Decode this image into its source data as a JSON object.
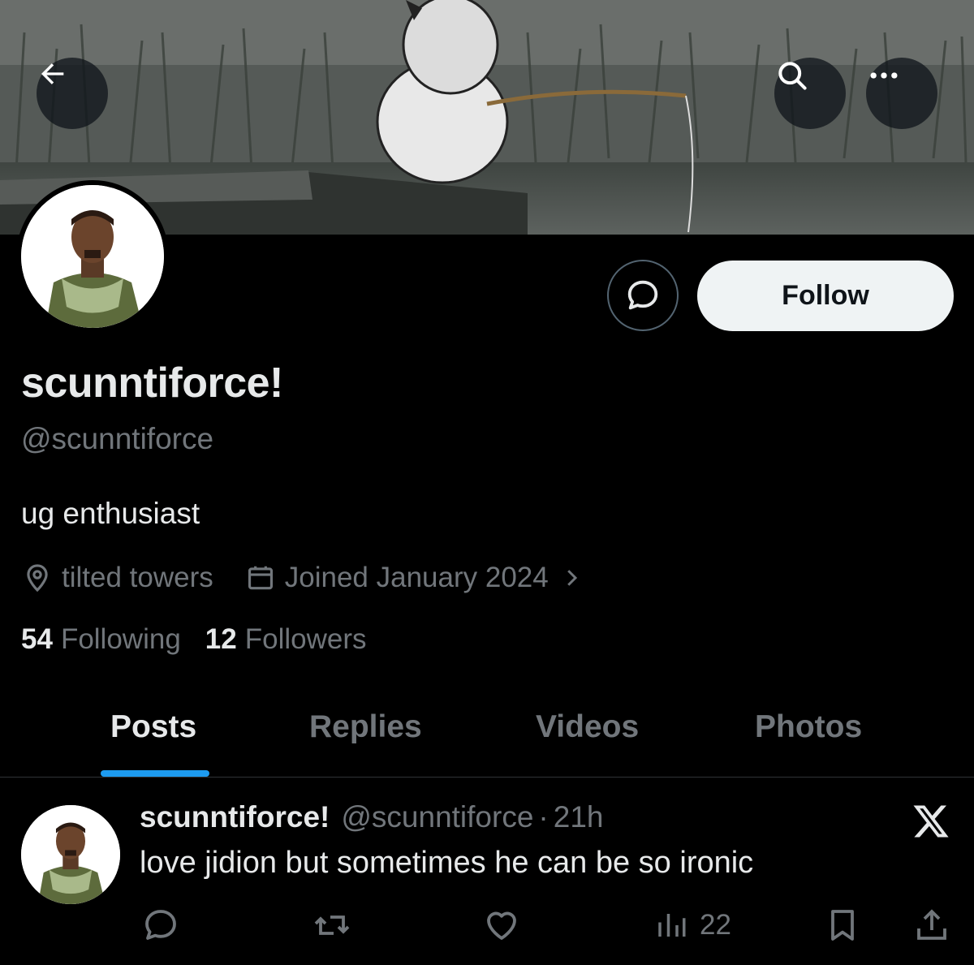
{
  "profile": {
    "display_name": "scunntiforce!",
    "handle": "@scunntiforce",
    "bio": "ug enthusiast",
    "location": "tilted towers",
    "joined": "Joined January 2024",
    "following_count": "54",
    "following_label": "Following",
    "followers_count": "12",
    "followers_label": "Followers"
  },
  "actions": {
    "follow_label": "Follow"
  },
  "tabs": [
    {
      "label": "Posts",
      "active": true
    },
    {
      "label": "Replies",
      "active": false
    },
    {
      "label": "Videos",
      "active": false
    },
    {
      "label": "Photos",
      "active": false
    }
  ],
  "post": {
    "author_name": "scunntiforce!",
    "author_handle": "@scunntiforce",
    "separator": "·",
    "time": "21h",
    "text": "love jidion but sometimes he can be so ironic",
    "views": "22"
  },
  "icons": {
    "back": "arrow-left-icon",
    "search": "search-icon",
    "more": "more-horizontal-icon",
    "message": "message-bubble-icon",
    "location": "location-pin-icon",
    "calendar": "calendar-icon",
    "chevron": "chevron-right-icon",
    "brand": "x-logo-icon",
    "reply": "reply-icon",
    "repost": "repost-icon",
    "like": "heart-icon",
    "views": "views-chart-icon",
    "bookmark": "bookmark-icon",
    "share": "share-icon"
  },
  "colors": {
    "background": "#000000",
    "text_primary": "#e7e9ea",
    "text_secondary": "#71767b",
    "accent": "#1d9bf0",
    "follow_bg": "#eff3f4"
  }
}
